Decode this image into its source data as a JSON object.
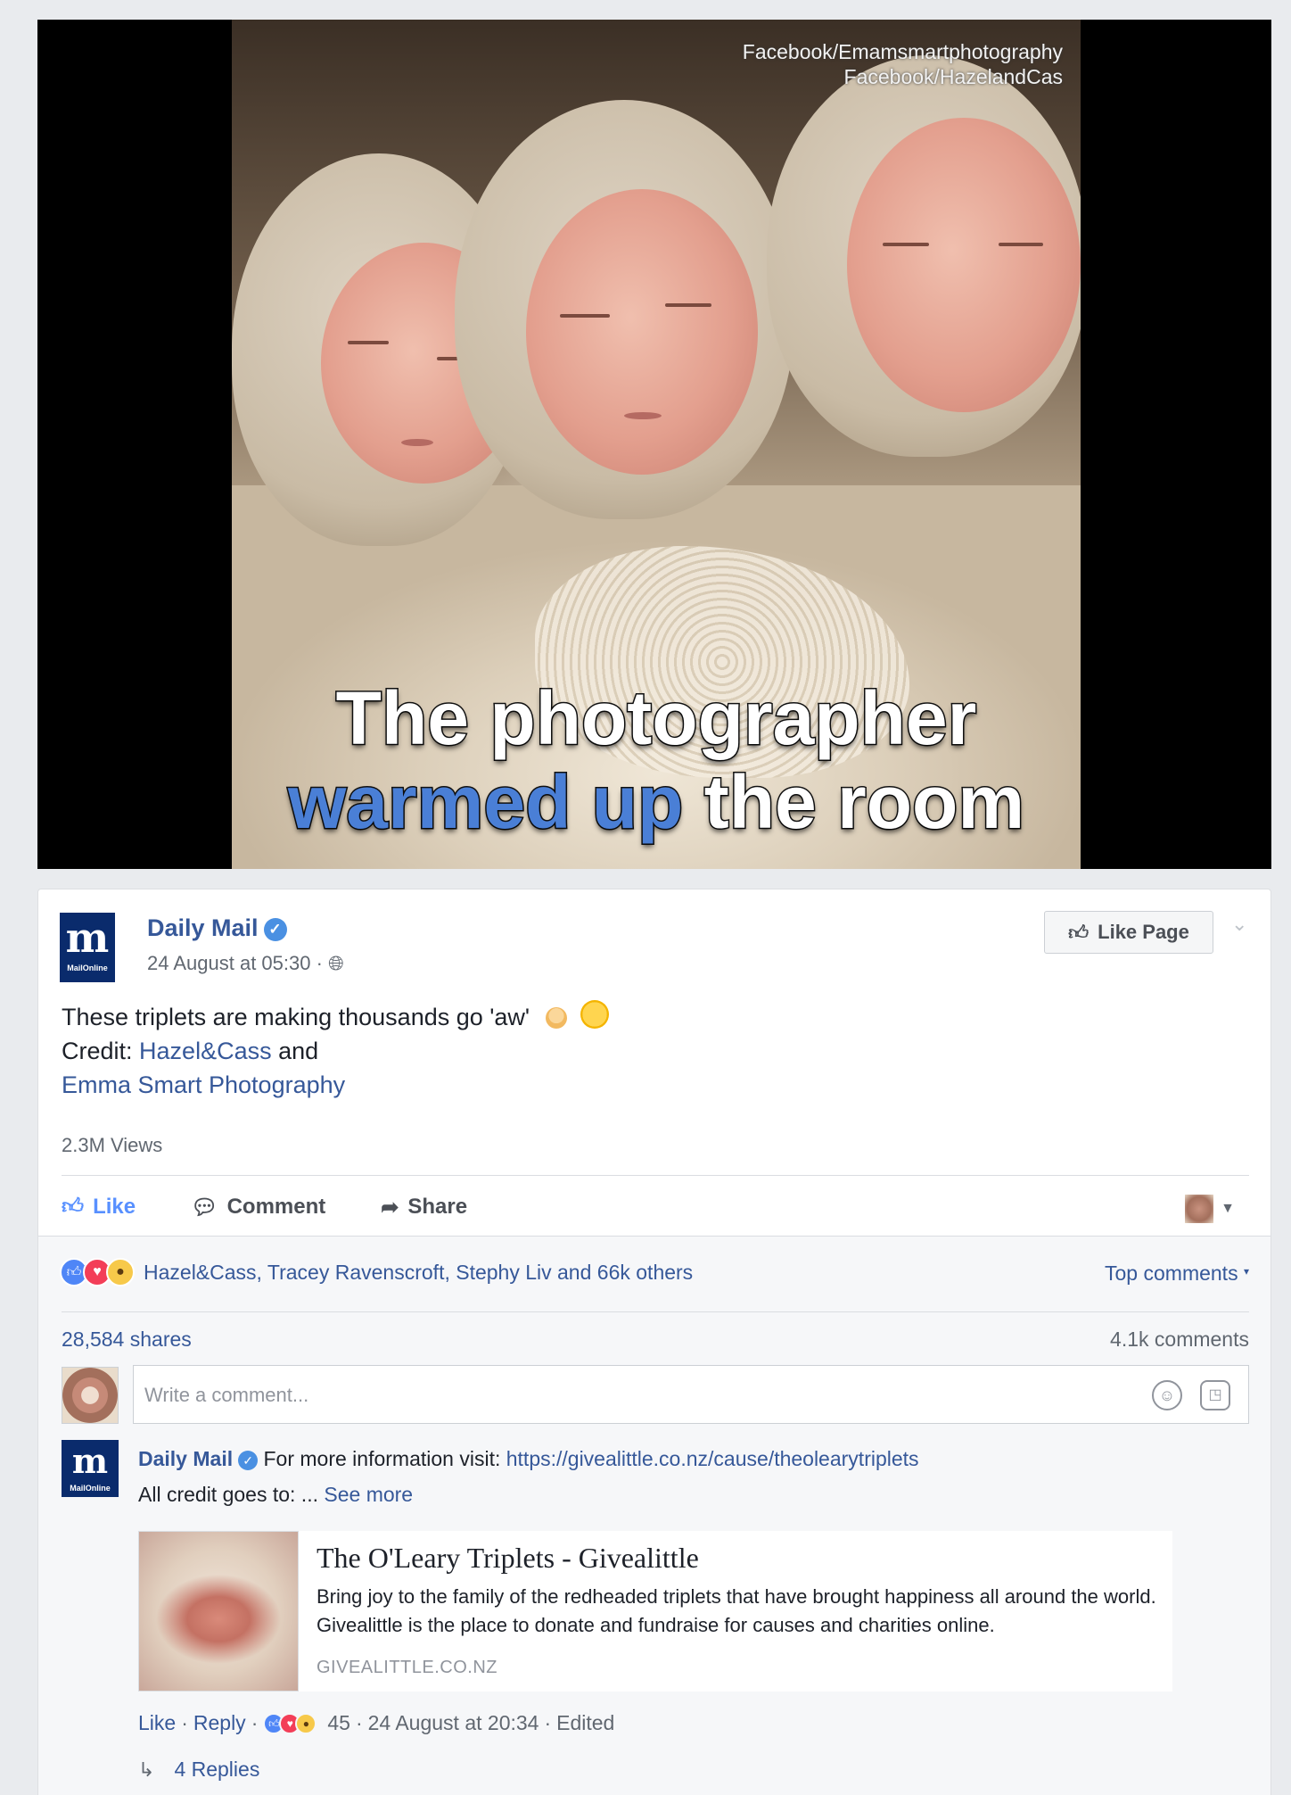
{
  "video": {
    "watermark_line1": "Facebook/Emamsmartphotography",
    "watermark_line2": "Facebook/HazelandCas",
    "caption_line1": "The photographer",
    "caption_hl1": "warmed",
    "caption_hl2": "up",
    "caption_rest": "the room"
  },
  "post": {
    "page_name": "Daily Mail",
    "logo_letter": "m",
    "logo_sub": "MailOnline",
    "timestamp": "24 August at 05:30 ·",
    "like_page_label": "Like Page",
    "text_line1": "These triplets are making thousands go 'aw'",
    "credit_prefix": "Credit:",
    "credit_link1": "Hazel&Cass",
    "credit_and": "and",
    "credit_link2": "Emma Smart Photography",
    "views": "2.3M Views",
    "actions": {
      "like": "Like",
      "comment": "Comment",
      "share": "Share"
    }
  },
  "engagement": {
    "reactors": "Hazel&Cass, Tracey Ravenscroft, Stephy Liv and 66k others",
    "top_comments": "Top comments",
    "shares": "28,584 shares",
    "comments_count": "4.1k comments",
    "comment_placeholder": "Write a comment..."
  },
  "comment": {
    "author": "Daily Mail",
    "text_prefix": "For more information visit:",
    "link": "https://givealittle.co.nz/cause/theolearytriplets",
    "line2_prefix": "All credit goes to: ...",
    "see_more": "See more",
    "card": {
      "title": "The O'Leary Triplets - Givealittle",
      "description": "Bring joy to the family of the redheaded triplets that have brought happiness all around the world. Givealittle is the place to donate and fundraise for causes and charities online.",
      "domain": "GIVEALITTLE.CO.NZ"
    },
    "like": "Like",
    "reply": "Reply",
    "reaction_count": "45",
    "time": "24 August at 20:34",
    "edited": "Edited",
    "replies": "4 Replies"
  },
  "colors": {
    "link": "#365899",
    "like_blue": "#5890ff",
    "logo_navy": "#0a2b6c",
    "background": "#e9ebee"
  }
}
